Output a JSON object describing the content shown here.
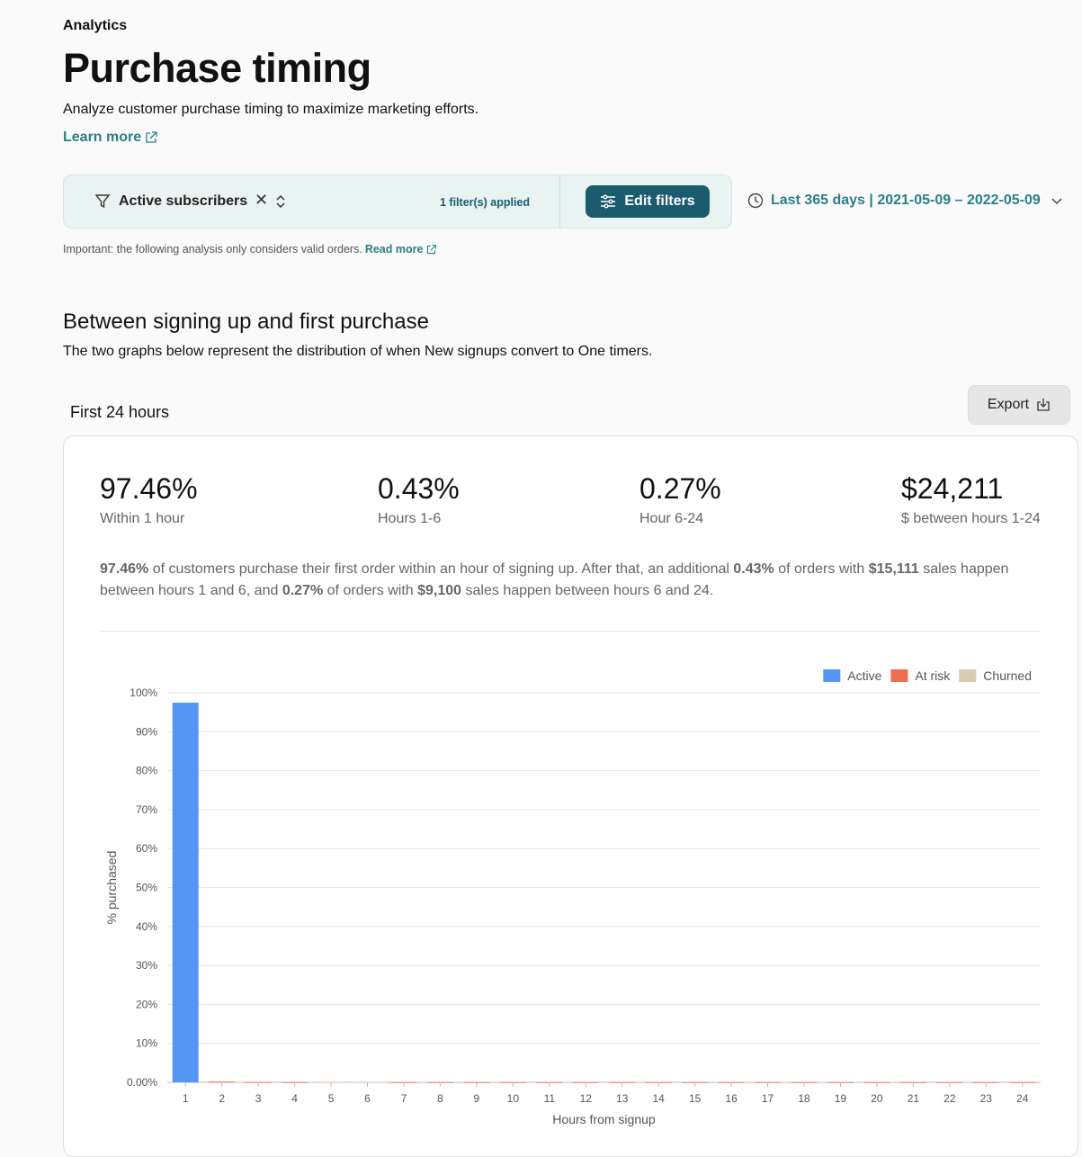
{
  "header": {
    "breadcrumb": "Analytics",
    "title": "Purchase timing",
    "subtitle": "Analyze customer purchase timing to maximize marketing efforts.",
    "learn_more": "Learn more"
  },
  "filters": {
    "active_filter": "Active subscribers",
    "count_text": "1 filter(s) applied",
    "edit_label": "Edit filters",
    "date_range": "Last 365 days | 2021-05-09 – 2022-05-09"
  },
  "note": {
    "text": "Important: the following analysis only considers valid orders.",
    "read_more": "Read more"
  },
  "section": {
    "title": "Between signing up and first purchase",
    "description": "The two graphs below represent the distribution of when New signups convert to One timers."
  },
  "card": {
    "title": "First 24 hours",
    "export_label": "Export",
    "stats": [
      {
        "value": "97.46%",
        "label": "Within 1 hour"
      },
      {
        "value": "0.43%",
        "label": "Hours 1-6"
      },
      {
        "value": "0.27%",
        "label": "Hour 6-24"
      },
      {
        "value": "$24,211",
        "label": "$ between hours 1-24"
      }
    ],
    "summary": {
      "p1_pct": "97.46%",
      "p1_text": " of customers purchase their first order within an hour of signing up. After that, an additional ",
      "p2_pct": "0.43%",
      "p2_text": " of orders with ",
      "p2_sales": "$15,111",
      "p2_tail": " sales happen between hours 1 and 6, and ",
      "p3_pct": "0.27%",
      "p3_text": " of orders with ",
      "p3_sales": "$9,100",
      "p3_tail": " sales happen between hours 6 and 24."
    }
  },
  "colors": {
    "active": "#5596f5",
    "at_risk": "#ef6c4f",
    "churned": "#d8cbb5",
    "accent": "#2a7f86",
    "button": "#1b5b6e"
  },
  "chart_data": {
    "type": "bar",
    "stacked": true,
    "categories": [
      "1",
      "2",
      "3",
      "4",
      "5",
      "6",
      "7",
      "8",
      "9",
      "10",
      "11",
      "12",
      "13",
      "14",
      "15",
      "16",
      "17",
      "18",
      "19",
      "20",
      "21",
      "22",
      "23",
      "24"
    ],
    "series": [
      {
        "name": "Active",
        "color": "#5596f5",
        "values": [
          97.46,
          0,
          0,
          0,
          0,
          0,
          0,
          0,
          0,
          0,
          0,
          0,
          0,
          0,
          0,
          0,
          0,
          0,
          0,
          0,
          0,
          0,
          0,
          0
        ]
      },
      {
        "name": "At risk",
        "color": "#ef6c4f",
        "values": [
          0,
          0.2,
          0.03,
          0.03,
          0.06,
          0.06,
          0.02,
          0.02,
          0.02,
          0.02,
          0.02,
          0.02,
          0.02,
          0.02,
          0.02,
          0.02,
          0.02,
          0.02,
          0.02,
          0.02,
          0.01,
          0.01,
          0.01,
          0.01
        ]
      },
      {
        "name": "Churned",
        "color": "#d8cbb5",
        "values": [
          0,
          0,
          0,
          0,
          0.03,
          0.02,
          0,
          0,
          0,
          0,
          0,
          0,
          0,
          0,
          0,
          0,
          0,
          0,
          0,
          0,
          0,
          0,
          0,
          0
        ]
      }
    ],
    "yticks": [
      "0.00%",
      "10%",
      "20%",
      "30%",
      "40%",
      "50%",
      "60%",
      "70%",
      "80%",
      "90%",
      "100%"
    ],
    "ylim": [
      0,
      100
    ],
    "xlabel": "Hours from signup",
    "ylabel": "% purchased",
    "legend_position": "top-right",
    "grid": true
  }
}
